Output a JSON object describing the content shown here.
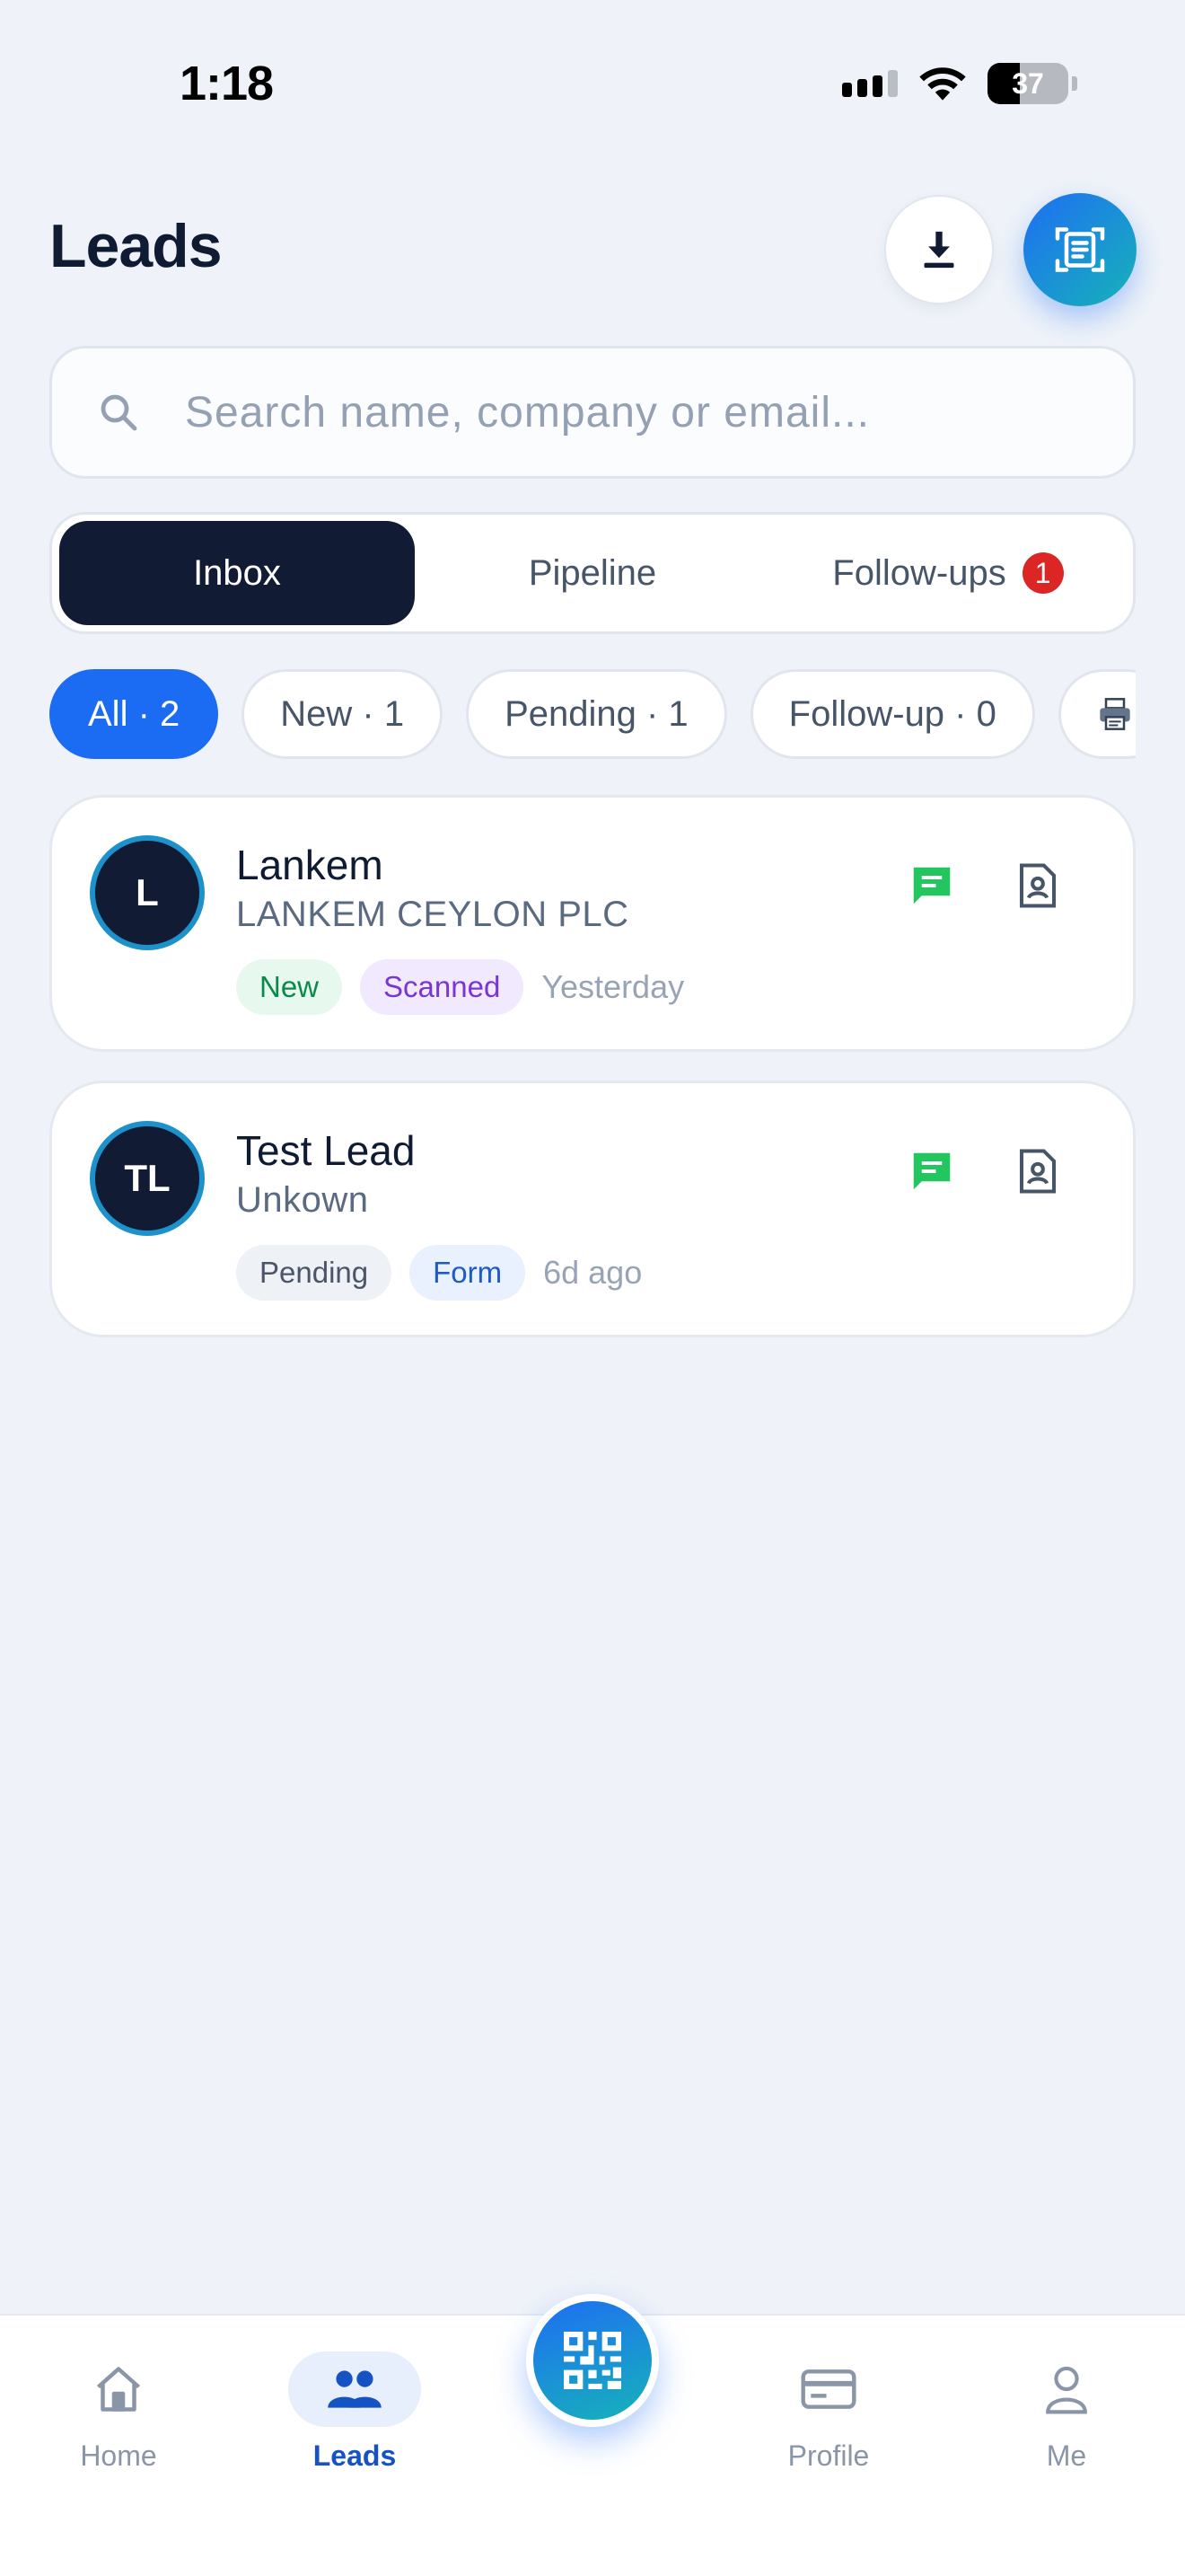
{
  "status_bar": {
    "time": "1:18",
    "battery": "37"
  },
  "header": {
    "title": "Leads"
  },
  "search": {
    "placeholder": "Search name, company or email..."
  },
  "segments": [
    {
      "label": "Inbox",
      "active": true
    },
    {
      "label": "Pipeline",
      "active": false
    },
    {
      "label": "Follow-ups",
      "active": false,
      "badge": "1"
    }
  ],
  "filters": [
    {
      "label": "All · 2",
      "active": true
    },
    {
      "label": "New · 1",
      "active": false
    },
    {
      "label": "Pending · 1",
      "active": false
    },
    {
      "label": "Follow-up · 0",
      "active": false
    },
    {
      "label": "",
      "icon": "printer-icon",
      "active": false
    }
  ],
  "leads": [
    {
      "initials": "L",
      "name": "Lankem",
      "company": "LANKEM CEYLON PLC",
      "status": "New",
      "source": "Scanned",
      "time": "Yesterday"
    },
    {
      "initials": "TL",
      "name": "Test Lead",
      "company": "Unkown",
      "status": "Pending",
      "source": "Form",
      "time": "6d ago"
    }
  ],
  "tabbar": {
    "items": [
      {
        "label": "Home",
        "icon": "home-icon",
        "active": false
      },
      {
        "label": "Leads",
        "icon": "people-icon",
        "active": true
      },
      {
        "label": "",
        "icon": "qr-code-icon",
        "active": false
      },
      {
        "label": "Profile",
        "icon": "card-icon",
        "active": false
      },
      {
        "label": "Me",
        "icon": "person-icon",
        "active": false
      }
    ]
  },
  "colors": {
    "accent": "#1b6cf2",
    "dark": "#111b33",
    "background": "#eff3f9",
    "badge": "#dc2626",
    "chat": "#22c55e"
  }
}
